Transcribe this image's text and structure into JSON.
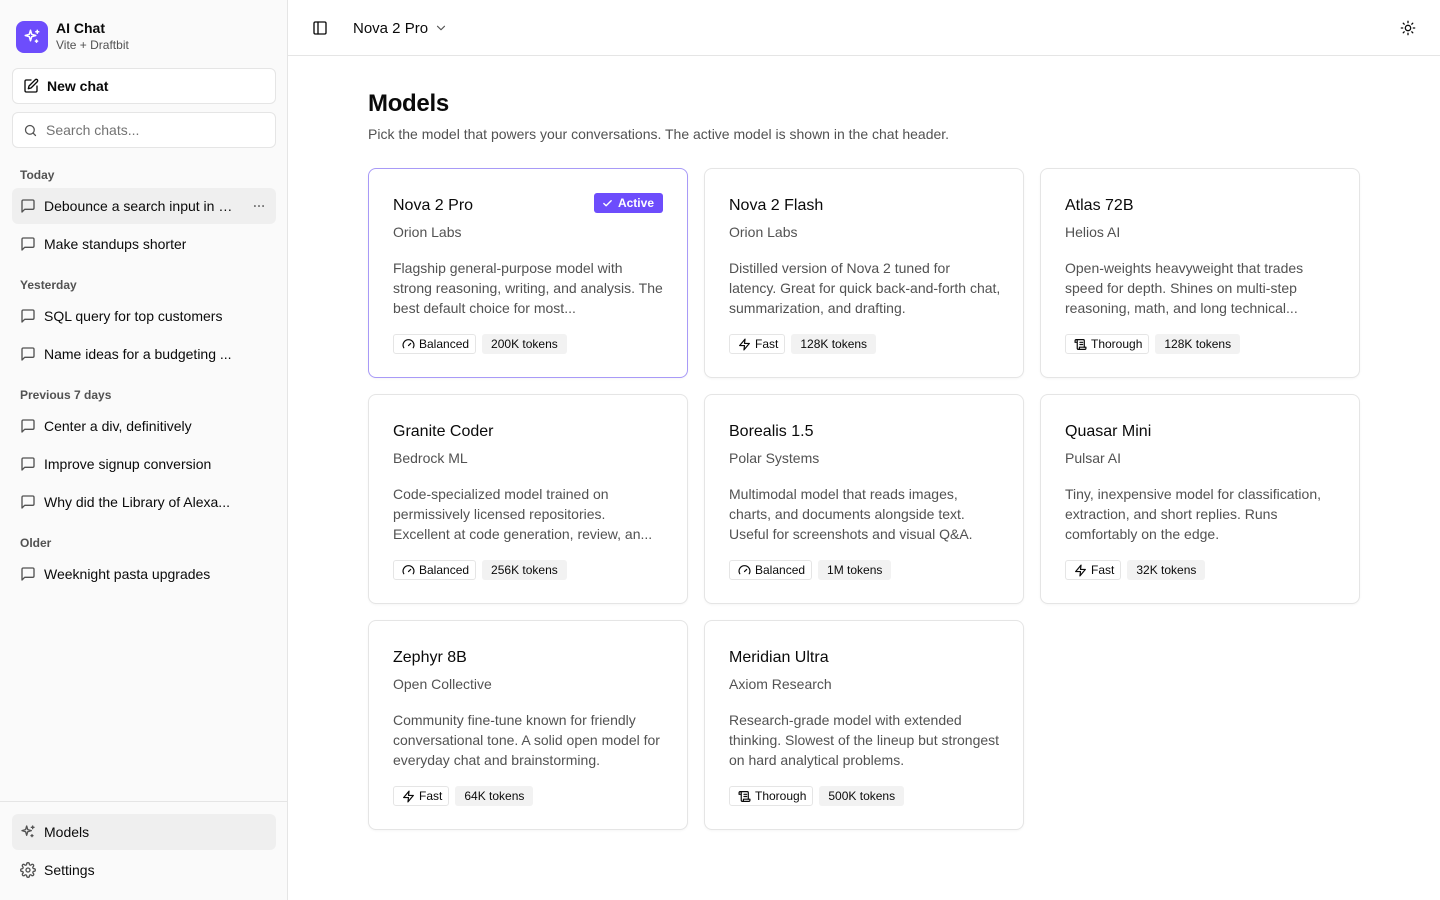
{
  "brand": {
    "title": "AI Chat",
    "subtitle": "Vite + Draftbit",
    "color": "#6d4dfc"
  },
  "sidebar": {
    "new_chat_label": "New chat",
    "search_placeholder": "Search chats...",
    "groups": [
      {
        "label": "Today",
        "items": [
          "Debounce a search input in R...",
          "Make standups shorter"
        ]
      },
      {
        "label": "Yesterday",
        "items": [
          "SQL query for top customers",
          "Name ideas for a budgeting ..."
        ]
      },
      {
        "label": "Previous 7 days",
        "items": [
          "Center a div, definitively",
          "Improve signup conversion",
          "Why did the Library of Alexa..."
        ]
      },
      {
        "label": "Older",
        "items": [
          "Weeknight pasta upgrades"
        ]
      }
    ],
    "footer": {
      "models_label": "Models",
      "settings_label": "Settings"
    }
  },
  "header": {
    "selected_model": "Nova 2 Pro"
  },
  "page": {
    "title": "Models",
    "description": "Pick the model that powers your conversations. The active model is shown in the chat header.",
    "active_badge": "Active"
  },
  "models": [
    {
      "name": "Nova 2 Pro",
      "vendor": "Orion Labs",
      "description": "Flagship general-purpose model with strong reasoning, writing, and analysis. The best default choice for most...",
      "speed": "Balanced",
      "speed_icon": "gauge-icon",
      "context": "200K tokens",
      "active": true
    },
    {
      "name": "Nova 2 Flash",
      "vendor": "Orion Labs",
      "description": "Distilled version of Nova 2 tuned for latency. Great for quick back-and-forth chat, summarization, and drafting.",
      "speed": "Fast",
      "speed_icon": "zap-icon",
      "context": "128K tokens",
      "active": false
    },
    {
      "name": "Atlas 72B",
      "vendor": "Helios AI",
      "description": "Open-weights heavyweight that trades speed for depth. Shines on multi-step reasoning, math, and long technical...",
      "speed": "Thorough",
      "speed_icon": "scroll-icon",
      "context": "128K tokens",
      "active": false
    },
    {
      "name": "Granite Coder",
      "vendor": "Bedrock ML",
      "description": "Code-specialized model trained on permissively licensed repositories. Excellent at code generation, review, an...",
      "speed": "Balanced",
      "speed_icon": "gauge-icon",
      "context": "256K tokens",
      "active": false
    },
    {
      "name": "Borealis 1.5",
      "vendor": "Polar Systems",
      "description": "Multimodal model that reads images, charts, and documents alongside text. Useful for screenshots and visual Q&A.",
      "speed": "Balanced",
      "speed_icon": "gauge-icon",
      "context": "1M tokens",
      "active": false
    },
    {
      "name": "Quasar Mini",
      "vendor": "Pulsar AI",
      "description": "Tiny, inexpensive model for classification, extraction, and short replies. Runs comfortably on the edge.",
      "speed": "Fast",
      "speed_icon": "zap-icon",
      "context": "32K tokens",
      "active": false
    },
    {
      "name": "Zephyr 8B",
      "vendor": "Open Collective",
      "description": "Community fine-tune known for friendly conversational tone. A solid open model for everyday chat and brainstorming.",
      "speed": "Fast",
      "speed_icon": "zap-icon",
      "context": "64K tokens",
      "active": false
    },
    {
      "name": "Meridian Ultra",
      "vendor": "Axiom Research",
      "description": "Research-grade model with extended thinking. Slowest of the lineup but strongest on hard analytical problems.",
      "speed": "Thorough",
      "speed_icon": "scroll-icon",
      "context": "500K tokens",
      "active": false
    }
  ]
}
